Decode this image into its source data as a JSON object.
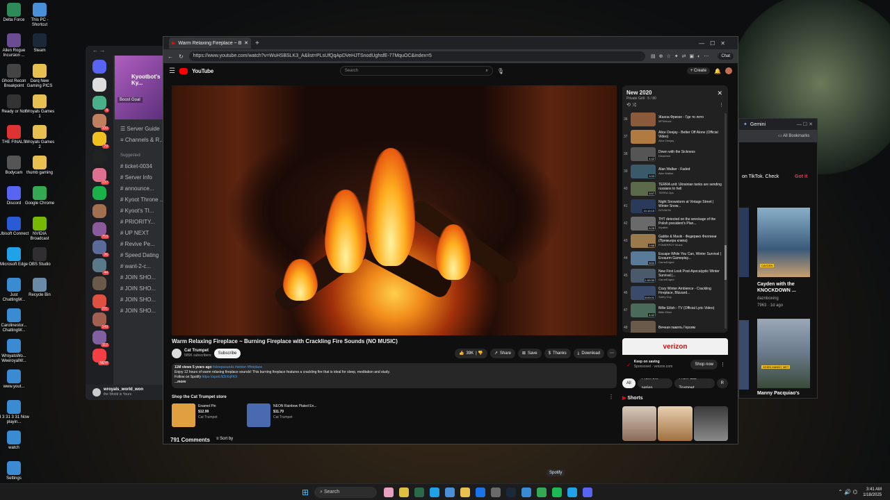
{
  "desktop": {
    "col1": [
      {
        "label": "Delta Force",
        "color": "#2e8b57"
      },
      {
        "label": "Allen Rogue Incursion ...",
        "color": "#6a4c93"
      },
      {
        "label": "Ghost Recon Breakpoint",
        "color": "#444"
      },
      {
        "label": "Ready or Not",
        "color": "#333"
      },
      {
        "label": "THE FINALS",
        "color": "#d33"
      },
      {
        "label": "Bodycam",
        "color": "#555"
      },
      {
        "label": "Discord",
        "color": "#5865f2"
      },
      {
        "label": "Ubisoft Connect",
        "color": "#2a5bd7"
      },
      {
        "label": "Microsoft Edge",
        "color": "#1fa2e8"
      },
      {
        "label": "Just ChattingW...",
        "color": "#3a8bd1"
      },
      {
        "label": "Carolinestor... ChattingW...",
        "color": "#3a8bd1"
      },
      {
        "label": "WroyalsWo... WeeroyalW...",
        "color": "#3a8bd1"
      },
      {
        "label": "www.yout...",
        "color": "#3a8bd1"
      },
      {
        "label": "4 3 31 3 31 Now playin...",
        "color": "#3a8bd1"
      },
      {
        "label": "watch",
        "color": "#3a8bd1"
      },
      {
        "label": "Settings",
        "color": "#3a8bd1"
      }
    ],
    "col2": [
      {
        "label": "This PC - Shortcut",
        "color": "#4a90d9"
      },
      {
        "label": "Steam",
        "color": "#1b2838"
      },
      {
        "label": "Darq New Gaming PICS",
        "color": "#e8c050"
      },
      {
        "label": "Wroyals Games 1",
        "color": "#e8c050"
      },
      {
        "label": "Wroyals Games 2",
        "color": "#e8c050"
      },
      {
        "label": "thumb gaming",
        "color": "#e8c050"
      },
      {
        "label": "Google Chrome",
        "color": "#34a853"
      },
      {
        "label": "NVIDIA Broadcast",
        "color": "#76b900"
      },
      {
        "label": "OBS Studio",
        "color": "#302e31"
      },
      {
        "label": "Recycle Bin",
        "color": "#6a8aa8"
      }
    ]
  },
  "discord": {
    "banner_title": "Kyootbot's Ky...",
    "boost_label": "Boost Goal",
    "menu": [
      "Server Guide",
      "Channels & R..."
    ],
    "suggested_label": "Suggested",
    "channels": [
      "ticket-0034",
      "Server Info",
      "announce...",
      "Kyoot Throne ...",
      "Kyoot's TI...",
      "PRIORITY...",
      "UP NEXT",
      "Revive Pe...",
      "Speed Dating",
      "want-2-c...",
      "JOIN SHO...",
      "JOIN SHO...",
      "JOIN SHO...",
      "JOIN SHO..."
    ],
    "user_name": "wroyals_world_won",
    "user_status": "the World is Yours",
    "server_badges": [
      "",
      "",
      "4",
      "100",
      "79",
      "",
      "132",
      "",
      "",
      "753",
      "26",
      "44",
      "",
      "231",
      "149",
      "112",
      "NEW"
    ]
  },
  "gemini": {
    "tab_label": "Gemini",
    "bookmarks_label": "All Bookmarks",
    "prompt_text": "on TikTok. Check",
    "got_it": "Got it",
    "video_title": "Cayden with the KNOCKDOWN ...",
    "channel": "daznboxing",
    "stats": "7963 · 1d ago",
    "video2_title": "Manny Pacquiao's"
  },
  "browser": {
    "tab_title": "Warm Relaxing Fireplace ~ B...",
    "url": "https://www.youtube.com/watch?v=WuHSBSLK3_A&list=PLsUfQqApDVeHJTSnodUghsfE-77MquOC&index=5",
    "chat_label": "Chat"
  },
  "youtube": {
    "logo": "YouTube",
    "search_placeholder": "Search",
    "create_label": "Create",
    "video_title": "Warm Relaxing Fireplace ~ Burning Fireplace with Crackling Fire Sounds (NO MUSIC)",
    "channel_name": "Cat Trumpet",
    "subscribers": "585K subscribers",
    "subscribe_label": "Subscribe",
    "likes": "39K",
    "share_label": "Share",
    "save_label": "Save",
    "thanks_label": "Thanks",
    "download_label": "Download",
    "desc_meta": "11M views  5 years ago",
    "desc_tags": "#sleepsounds #winter #fireplace",
    "desc_line1": "Enjoy 12 hours of warm relaxing fireplace sounds! This burning fireplace features a crackling fire that is ideal for sleep, meditation and study.",
    "desc_line2": "Follow on Spotify",
    "desc_link": "https://spoti.fi/2rXqFK9",
    "desc_more": "...more",
    "shop_title": "Shop the Cat Trumpet store",
    "products": [
      {
        "name": "Enamel Pin",
        "price": "$12.99",
        "seller": "Cat Trumpet"
      },
      {
        "name": "NEON Rainbow Plated En...",
        "price": "$11.70",
        "seller": "Cat Trumpet"
      }
    ],
    "comments_count": "791 Comments",
    "sort_label": "Sort by"
  },
  "playlist": {
    "title": "New 2020",
    "sub": "Private   Grill  ·  5 / 80",
    "items": [
      {
        "num": "36",
        "title": "Жанна Фриске - Где то лето",
        "channel": "MP3Music",
        "dur": "",
        "color": "#8a5a3a"
      },
      {
        "num": "37",
        "title": "Alice Deejay - Better Off Alone (Official Video)",
        "channel": "Alice Deejay",
        "dur": "",
        "color": "#b07a40"
      },
      {
        "num": "38",
        "title": "Down with the Sickness",
        "channel": "Disturbed",
        "dur": "4:42",
        "color": "#555"
      },
      {
        "num": "39",
        "title": "Alan Walker - Faded",
        "channel": "Alan Walker",
        "dur": "3:33",
        "color": "#3a5a6a"
      },
      {
        "num": "40",
        "title": "TERRA unit: Ukrainian tanks are sending russians to hell",
        "channel": "TERRA Ops",
        "dur": "3:57",
        "color": "#5a6a4a"
      },
      {
        "num": "41",
        "title": "Night Snowstorm at Vintage Street | Winter Snow...",
        "channel": "DOVAKIN",
        "dur": "10:10:15",
        "color": "#2a3a5a"
      },
      {
        "num": "42",
        "title": "THT detected on the wreckage of the Polish president's Plan...",
        "channel": "Wyatkrt",
        "dur": "5:25",
        "color": "#6a6a6a"
      },
      {
        "num": "43",
        "title": "Gabbe & Mavik - Федерико Феллини (Премьера клипа)",
        "channel": "FOMERROY Music",
        "dur": "2:56",
        "color": "#9a7a4a"
      },
      {
        "num": "44",
        "title": "Escape While You Can, Winter Survival | Erzaurm Gameplay...",
        "channel": "GameEdged",
        "dur": "3:01",
        "color": "#5a7a9a"
      },
      {
        "num": "45",
        "title": "New First Look Post-Apocalyptic Winter Survival |...",
        "channel": "GameEdged",
        "dur": "1:09:30",
        "color": "#4a5a6a"
      },
      {
        "num": "46",
        "title": "Cozy Winter Ambience - Crackling Fireplace, Blizzard...",
        "channel": "Sabry Guy",
        "dur": "8:00:01",
        "color": "#3a4a6a"
      },
      {
        "num": "47",
        "title": "Billie Eilish - TV (Official Lyric Video)",
        "channel": "Billie Eilish",
        "dur": "4:42",
        "color": "#4a6a5a"
      },
      {
        "num": "48",
        "title": "Вечная память Героям",
        "channel": "",
        "dur": "",
        "color": "#6a5a4a"
      }
    ]
  },
  "ad": {
    "brand": "verizon",
    "line1": "Keep on saving",
    "line2": "Sponsored · verizon.com",
    "cta": "Shop now"
  },
  "chips": [
    "All",
    "From the series",
    "From Cat Trumpet",
    "R"
  ],
  "shorts_label": "Shorts",
  "taskbar": {
    "search_label": "Search",
    "tooltip": "Spotify",
    "time": "3:41 AM",
    "date": "1/18/2025"
  }
}
